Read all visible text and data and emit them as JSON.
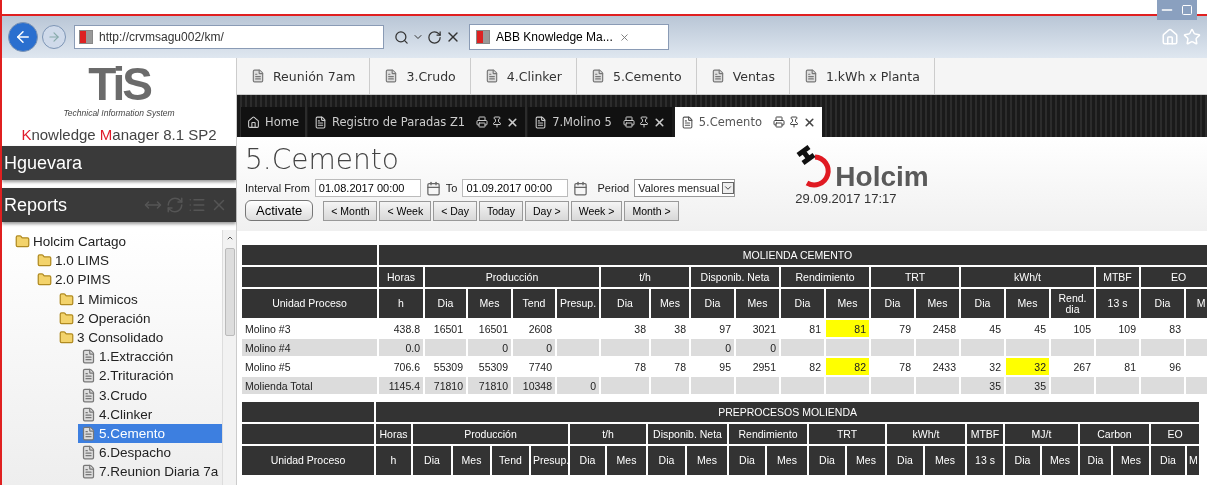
{
  "browser": {
    "url": "http://crvmsagu002/km/",
    "tab": "ABB Knowledge Ma..."
  },
  "sidebar": {
    "logo": "TiS",
    "tagline": "Technical Information System",
    "product": [
      {
        "text": "K",
        "accent": true
      },
      {
        "text": "nowledge ",
        "accent": false
      },
      {
        "text": "M",
        "accent": true
      },
      {
        "text": "anager 8.1 SP2",
        "accent": false
      }
    ],
    "user": "Hguevara",
    "panel_title": "Reports",
    "tree": [
      {
        "label": "Holcim Cartago",
        "kind": "folder",
        "selected": false,
        "children": [
          {
            "label": "1.0 LIMS",
            "kind": "folder",
            "selected": false
          },
          {
            "label": "2.0 PIMS",
            "kind": "folder",
            "selected": false,
            "children": [
              {
                "label": "1 Mimicos",
                "kind": "folder",
                "selected": false
              },
              {
                "label": "2 Operación",
                "kind": "folder",
                "selected": false
              },
              {
                "label": "3 Consolidado",
                "kind": "folder",
                "selected": false,
                "children": [
                  {
                    "label": "1.Extracción",
                    "kind": "report",
                    "selected": false
                  },
                  {
                    "label": "2.Trituración",
                    "kind": "report",
                    "selected": false
                  },
                  {
                    "label": "3.Crudo",
                    "kind": "report",
                    "selected": false
                  },
                  {
                    "label": "4.Clinker",
                    "kind": "report",
                    "selected": false
                  },
                  {
                    "label": "5.Cemento",
                    "kind": "report",
                    "selected": true
                  },
                  {
                    "label": "6.Despacho",
                    "kind": "report",
                    "selected": false
                  },
                  {
                    "label": "7.Reunion Diaria 7a",
                    "kind": "report",
                    "selected": false
                  }
                ]
              }
            ]
          }
        ]
      }
    ]
  },
  "top_tabs": [
    "Reunión 7am",
    "3.Crudo",
    "4.Clinker",
    "5.Cemento",
    "Ventas",
    "1.kWh x Planta"
  ],
  "doc_tabs": [
    {
      "label": "Home",
      "kind": "home",
      "selected": false
    },
    {
      "label": "Registro de Paradas Z1",
      "kind": "report",
      "selected": false
    },
    {
      "label": "7.Molino 5",
      "kind": "report",
      "selected": false
    },
    {
      "label": "5.Cemento",
      "kind": "report",
      "selected": true
    }
  ],
  "report": {
    "title": "5.Cemento",
    "from_label": "Interval From",
    "from": "01.08.2017 00:00",
    "to_label": "To",
    "to": "01.09.2017 00:00",
    "period_label": "Period",
    "period": "Valores mensual",
    "activate": "Activate",
    "nav": [
      "< Month",
      "< Week",
      "< Day",
      "Today",
      "Day >",
      "Week >",
      "Month >"
    ],
    "brand": "Holcim",
    "timestamp": "29.09.2017 17:17"
  },
  "tables": [
    {
      "title": "MOLIENDA CEMENTO",
      "groups": [
        "Horas",
        "Producción",
        "t/h",
        "Disponib. Neta",
        "Rendimiento",
        "TRT",
        "kWh/t",
        "MTBF",
        "EO"
      ],
      "columns": [
        "Unidad Proceso",
        "h",
        "Dia",
        "Mes",
        "Tend",
        "Presup.",
        "Dia",
        "Mes",
        "Dia",
        "Mes",
        "Dia",
        "Mes",
        "Dia",
        "Mes",
        "Dia",
        "Mes",
        "Rend. dia",
        "13 s",
        "Dia",
        "M"
      ],
      "rows": [
        {
          "cells": [
            "Molino #3",
            "438.8",
            "16501",
            "16501",
            "2608",
            null,
            "38",
            "38",
            "97",
            "3021",
            "81",
            {
              "text": "81",
              "highlighted": true
            },
            "79",
            "2458",
            "45",
            "45",
            "105",
            "109",
            "83",
            null
          ]
        },
        {
          "cells": [
            "Molino #4",
            "0.0",
            null,
            "0",
            "0",
            null,
            null,
            null,
            "0",
            "0",
            null,
            null,
            null,
            null,
            null,
            null,
            null,
            null,
            null,
            null
          ]
        },
        {
          "cells": [
            "Molino #5",
            "706.6",
            "55309",
            "55309",
            "7740",
            null,
            "78",
            "78",
            "95",
            "2951",
            "82",
            {
              "text": "82",
              "highlighted": true
            },
            "78",
            "2433",
            "32",
            {
              "text": "32",
              "highlighted": true
            },
            "267",
            "81",
            "96",
            null
          ]
        },
        {
          "cells": [
            "Molienda Total",
            "1145.4",
            "71810",
            "71810",
            "10348",
            "0",
            null,
            null,
            null,
            null,
            null,
            null,
            null,
            null,
            "35",
            "35",
            null,
            null,
            null,
            null
          ]
        }
      ]
    },
    {
      "title": "PREPROCESOS MOLIENDA",
      "groups": [
        "Horas",
        "Producción",
        "t/h",
        "Disponib. Neta",
        "Rendimiento",
        "TRT",
        "kWh/t",
        "MTBF",
        "MJ/t",
        "Carbon",
        "EO"
      ],
      "columns": [
        "Unidad Proceso",
        "h",
        "Dia",
        "Mes",
        "Tend",
        "Presup.",
        "Dia",
        "Mes",
        "Dia",
        "Mes",
        "Dia",
        "Mes",
        "Dia",
        "Mes",
        "Dia",
        "Mes",
        "13 s",
        "Dia",
        "Mes",
        "Dia",
        "Mes",
        "Dia",
        "M"
      ]
    }
  ]
}
